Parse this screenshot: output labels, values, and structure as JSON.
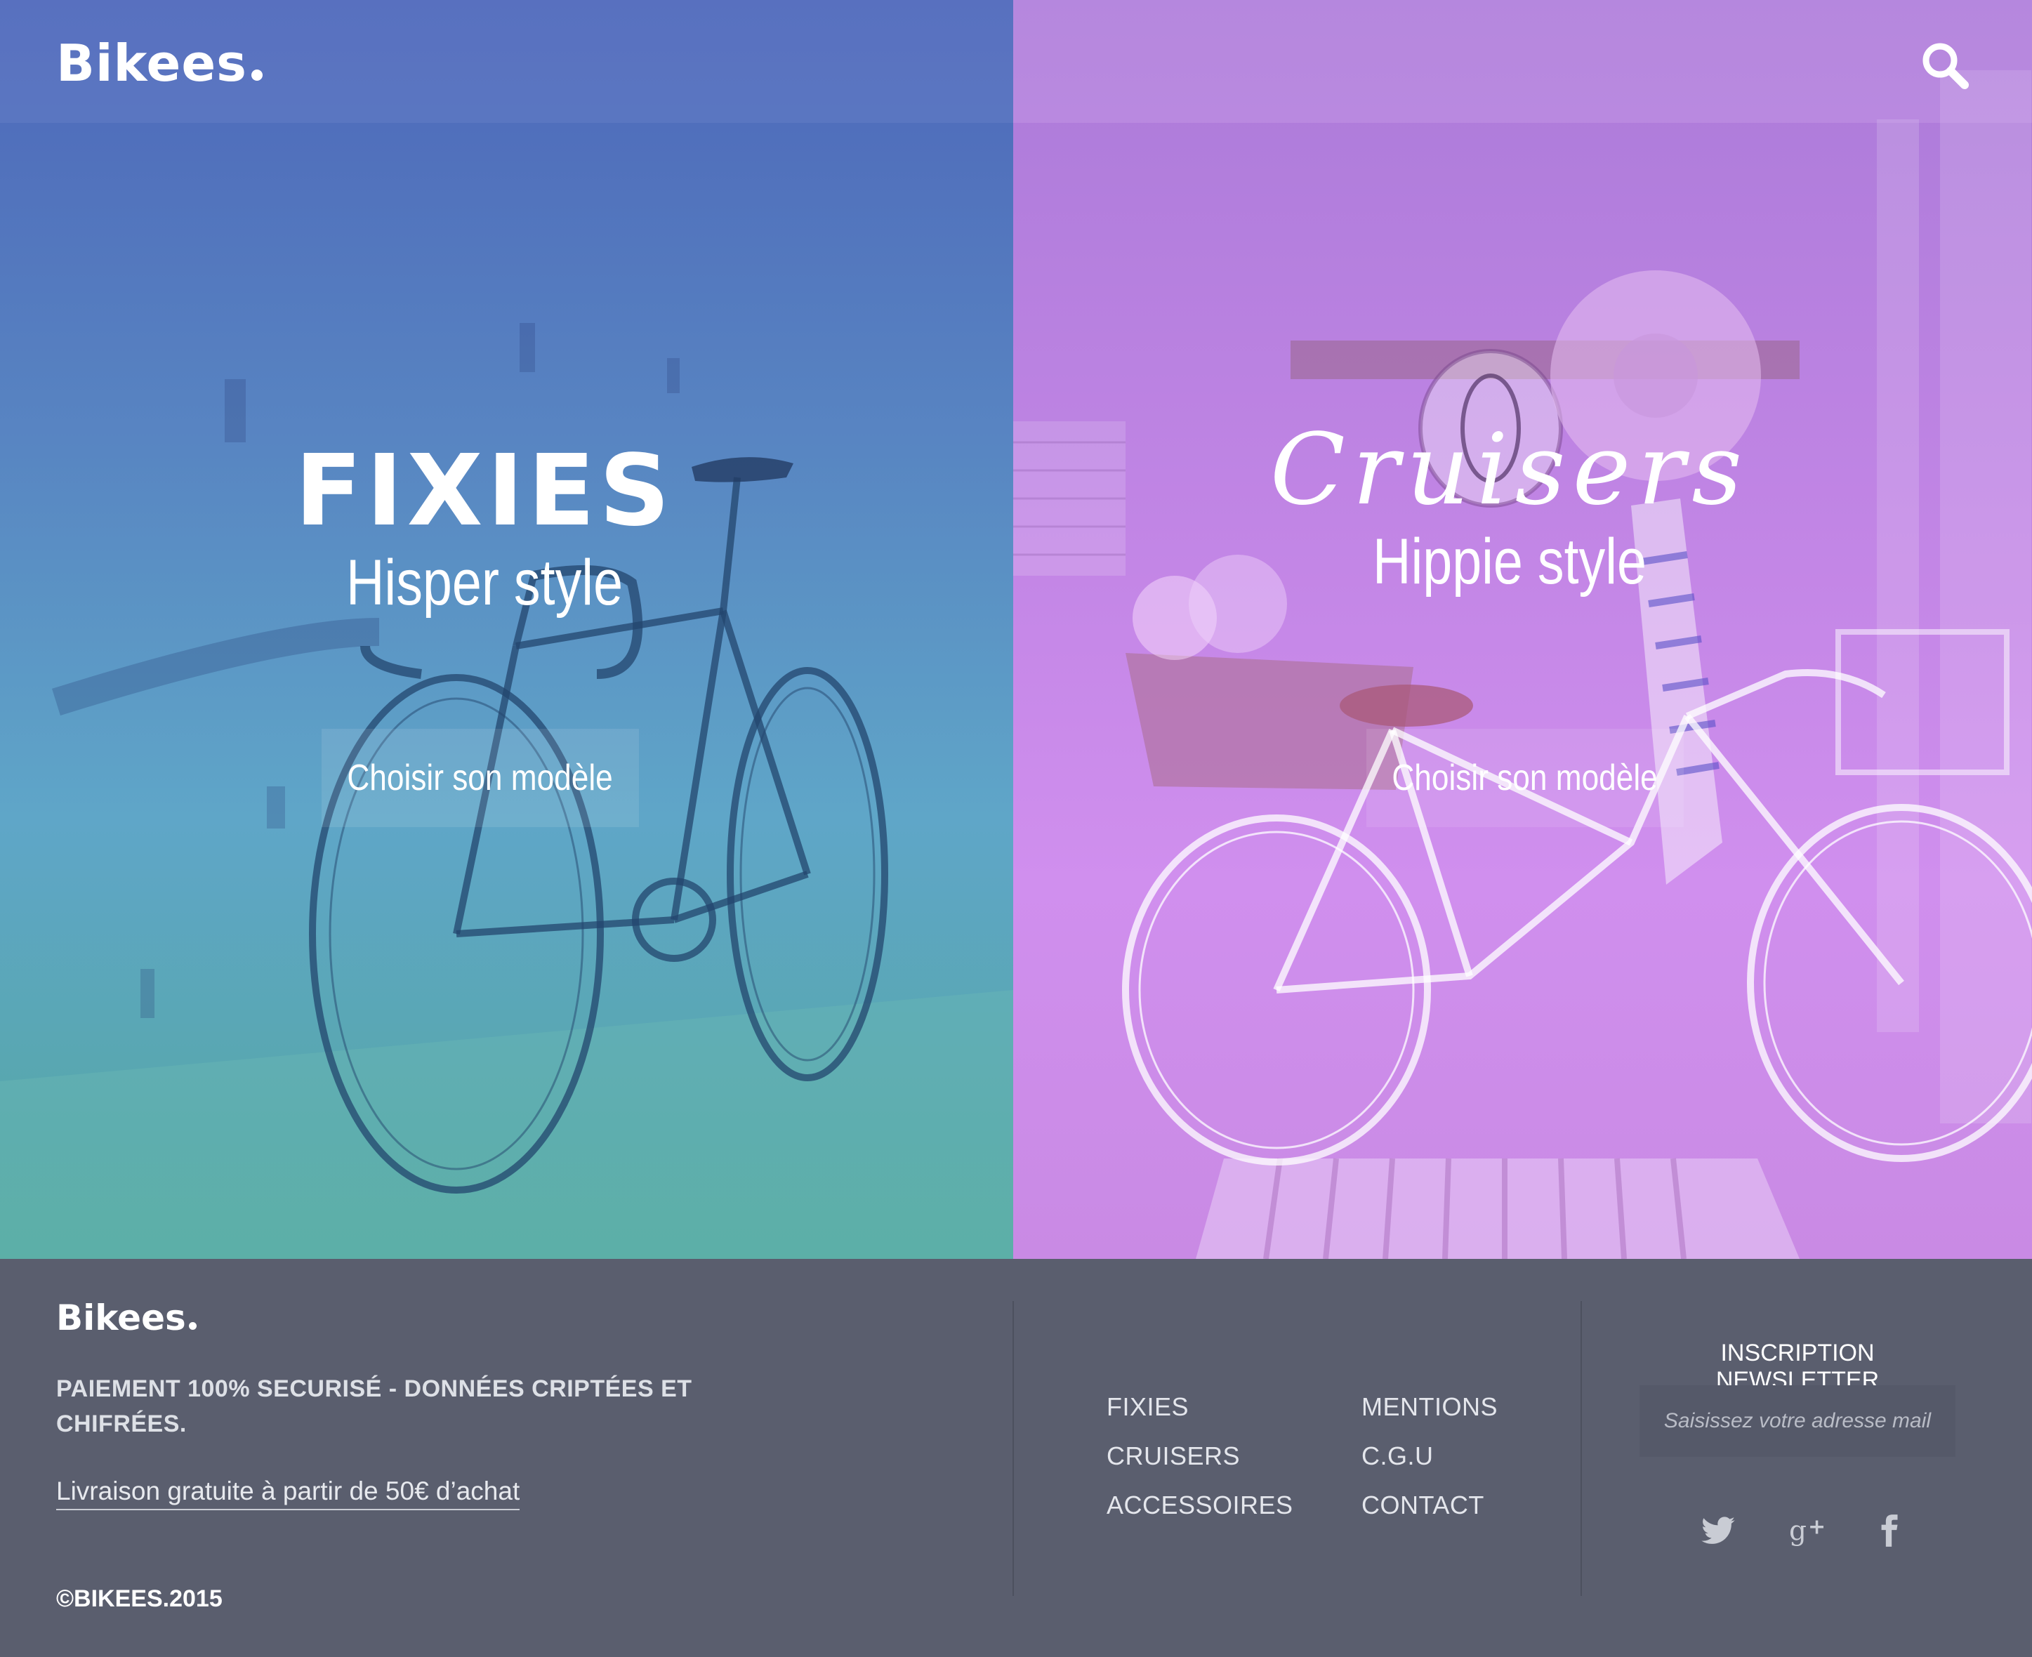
{
  "header": {
    "logo": "Bikees",
    "search_icon": "search-icon"
  },
  "panels": [
    {
      "key": "fixies",
      "title": "FIXIES",
      "subtitle": "Hisper style",
      "cta": "Choisir son modèle",
      "overlay_color": "#5174c0"
    },
    {
      "key": "cruisers",
      "title": "Cruisers",
      "subtitle": "Hippie style",
      "cta": "Choisir son modèle",
      "overlay_color": "#c186e6"
    }
  ],
  "footer": {
    "logo": "Bikees",
    "secure_text": "PAIEMENT 100% SECURISÉ - DONNÉES CRIPTÉES ET CHIFRÉES.",
    "shipping_link": "Livraison gratuite à partir de 50€ d’achat",
    "copyright": "©BIKEES.2015",
    "nav_col1": [
      "FIXIES",
      "CRUISERS",
      "ACCESSOIRES"
    ],
    "nav_col2": [
      "MENTIONS",
      "C.G.U",
      "CONTACT"
    ],
    "newsletter": {
      "title": "INSCRIPTION NEWSLETTER",
      "placeholder": "Saisissez votre adresse mail"
    },
    "social": [
      "twitter-icon",
      "google-plus-icon",
      "facebook-icon"
    ],
    "background_color": "#5a5e6e"
  }
}
